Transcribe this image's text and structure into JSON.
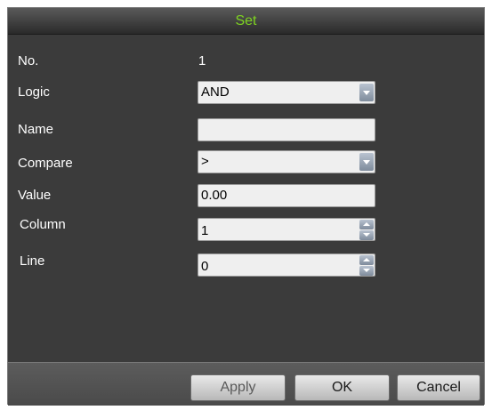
{
  "window": {
    "title": "Set"
  },
  "fields": {
    "no": {
      "label": "No.",
      "value": "1"
    },
    "logic": {
      "label": "Logic",
      "value": "AND"
    },
    "name": {
      "label": "Name",
      "value": ""
    },
    "compare": {
      "label": "Compare",
      "value": ">"
    },
    "value": {
      "label": "Value",
      "value": "0.00"
    },
    "column": {
      "label": "Column",
      "value": "1"
    },
    "line": {
      "label": "Line",
      "value": "0"
    }
  },
  "buttons": {
    "apply": "Apply",
    "ok": "OK",
    "cancel": "Cancel"
  },
  "colors": {
    "title_text": "#7ed321",
    "background": "#3b3b3b"
  }
}
